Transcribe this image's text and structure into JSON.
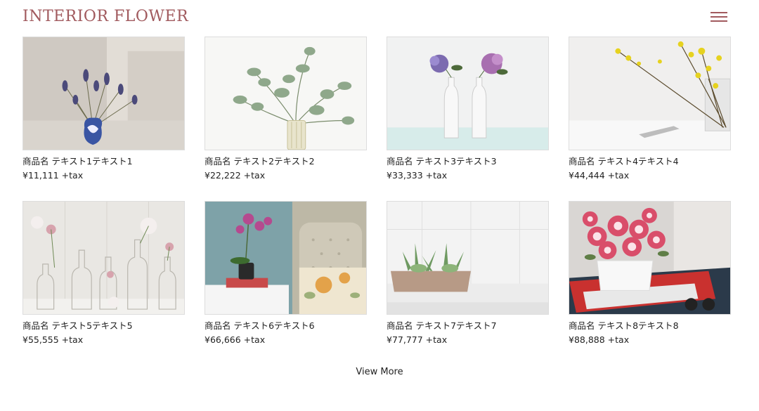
{
  "header": {
    "brand": "INTERIOR FLOWER",
    "menu_icon": "hamburger-menu-icon"
  },
  "products": [
    {
      "name": "商品名 テキスト1テキスト1",
      "price": "¥11,111 +tax",
      "image": "lavender-vase-photo"
    },
    {
      "name": "商品名 テキスト2テキスト2",
      "price": "¥22,222 +tax",
      "image": "eucalyptus-vase-photo"
    },
    {
      "name": "商品名 テキスト3テキスト3",
      "price": "¥33,333 +tax",
      "image": "hydrangea-vases-photo"
    },
    {
      "name": "商品名 テキスト4テキスト4",
      "price": "¥44,444 +tax",
      "image": "yellow-flower-table-photo"
    },
    {
      "name": "商品名 テキスト5テキスト5",
      "price": "¥55,555 +tax",
      "image": "bottles-flowers-photo"
    },
    {
      "name": "商品名 テキスト6テキスト6",
      "price": "¥66,666 +tax",
      "image": "orchid-bedroom-photo"
    },
    {
      "name": "商品名 テキスト7テキスト7",
      "price": "¥77,777 +tax",
      "image": "succulent-planter-photo"
    },
    {
      "name": "商品名 テキスト8テキスト8",
      "price": "¥88,888 +tax",
      "image": "pink-flowers-magazines-photo"
    }
  ],
  "footer": {
    "view_more": "View More"
  }
}
